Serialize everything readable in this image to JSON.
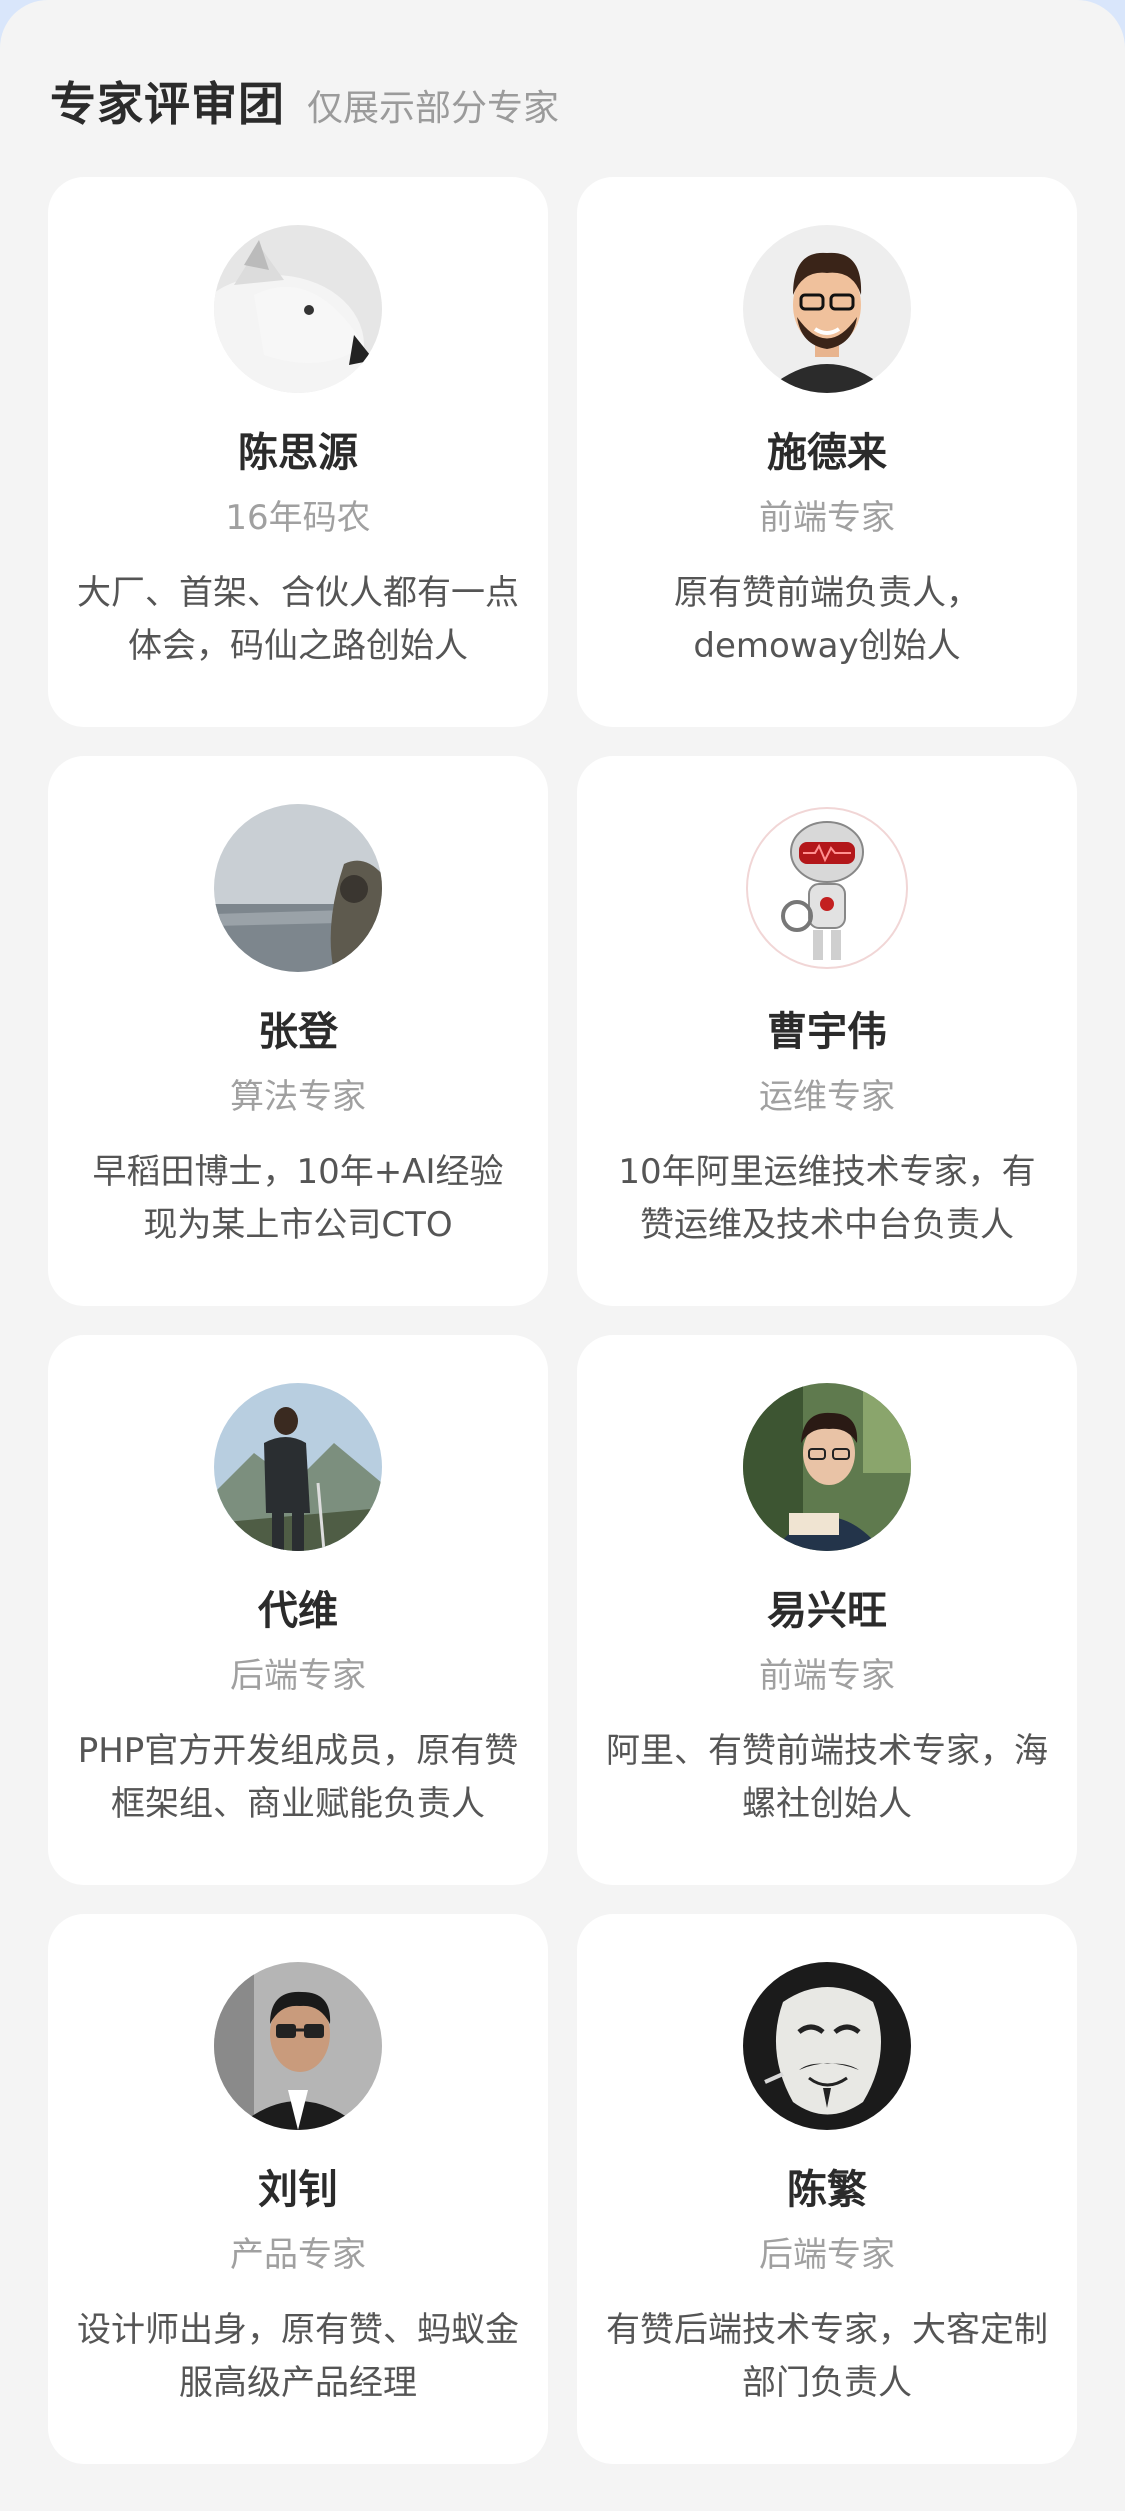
{
  "header": {
    "title": "专家评审团",
    "subtitle": "仅展示部分专家"
  },
  "experts": [
    {
      "name": "陈思源",
      "role": "16年码农",
      "desc": "大厂、首架、合伙人都有一点体会，码仙之路创始人",
      "avatar_icon": "white-wolf-avatar"
    },
    {
      "name": "施德来",
      "role": "前端专家",
      "desc": "原有赞前端负责人，demoway创始人",
      "avatar_icon": "cartoon-man-glasses-avatar"
    },
    {
      "name": "张登",
      "role": "算法专家",
      "desc": "早稻田博士，10年+AI经验现为某上市公司CTO",
      "avatar_icon": "seaside-photo-avatar"
    },
    {
      "name": "曹宇伟",
      "role": "运维专家",
      "desc": "10年阿里运维技术专家，有赞运维及技术中台负责人",
      "avatar_icon": "robot-doctor-avatar"
    },
    {
      "name": "代维",
      "role": "后端专家",
      "desc": "PHP官方开发组成员，原有赞框架组、商业赋能负责人",
      "avatar_icon": "hiker-mountain-avatar"
    },
    {
      "name": "易兴旺",
      "role": "前端专家",
      "desc": "阿里、有赞前端技术专家，海螺社创始人",
      "avatar_icon": "young-man-reading-avatar"
    },
    {
      "name": "刘钊",
      "role": "产品专家",
      "desc": "设计师出身，原有赞、蚂蚁金服高级产品经理",
      "avatar_icon": "man-glasses-suit-avatar"
    },
    {
      "name": "陈繁",
      "role": "后端专家",
      "desc": "有赞后端技术专家，大客定制部门负责人",
      "avatar_icon": "guy-fawkes-mask-avatar"
    }
  ]
}
